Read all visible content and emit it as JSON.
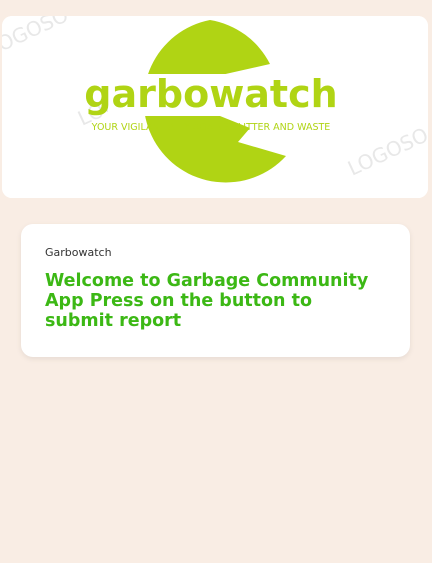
{
  "banner": {
    "logo_text": "garbowatch",
    "tagline": "YOUR VIGILANT ALLY AGAINST LITTER AND WASTE",
    "logo_color": "#b0d414",
    "watermark": "LOGOSO"
  },
  "card": {
    "label": "Garbowatch",
    "title": "Welcome to Garbage Community App Press on the button to submit report"
  },
  "colors": {
    "background": "#f9ede4",
    "accent": "#3cb815",
    "logo": "#b0d414"
  }
}
